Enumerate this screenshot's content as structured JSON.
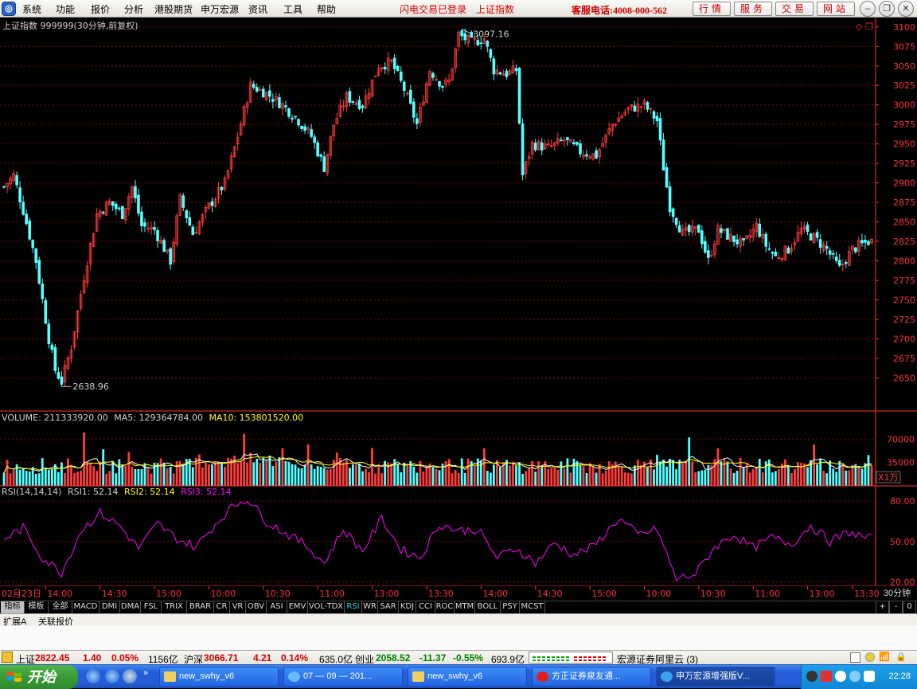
{
  "menubar": {
    "items": [
      "系统",
      "功能",
      "报价",
      "分析",
      "港股期货",
      "申万宏源",
      "资讯",
      "工具",
      "帮助"
    ],
    "flash_status": "闪电交易已登录",
    "current_index": "上证指数",
    "hotline": "客服电话:4008-000-562",
    "buttons": [
      "行情",
      "服务",
      "交易",
      "网站"
    ]
  },
  "chart": {
    "title": "上证指数 999999(30分钟,前复权)",
    "high_label": "3097.16",
    "low_label": "2638.96",
    "price_ticks": [
      "3100",
      "3075",
      "3050",
      "3025",
      "3000",
      "2975",
      "2950",
      "2925",
      "2900",
      "2875",
      "2850",
      "2825",
      "2800",
      "2775",
      "2750",
      "2725",
      "2700",
      "2675",
      "2650"
    ],
    "volume_header": {
      "label": "VOLUME: 211333920.00",
      "ma5": "MA5: 129364784.00",
      "ma10": "MA10: 153801520.00"
    },
    "volume_ticks": [
      "70000",
      "35000"
    ],
    "volume_unit": "X1万",
    "rsi_header": {
      "label": "RSI(14,14,14)",
      "rsi1": "RSI1: 52.14",
      "rsi2": "RSI2: 52.14",
      "rsi3": "RSI3: 52.14"
    },
    "rsi_ticks": [
      "80.00",
      "50.00",
      "20.00"
    ],
    "time_axis": [
      "02月23日",
      "14:00",
      "14:30",
      "15:00",
      "10:00",
      "10:30",
      "11:00",
      "13:00",
      "13:30",
      "14:00",
      "14:30",
      "15:00",
      "10:00",
      "10:30",
      "11:00",
      "13:00",
      "13:30"
    ],
    "colors": {
      "up": "#ff3c3c",
      "down": "#54ffff",
      "grid": "#8b0000",
      "ma5": "#ffffff",
      "ma10": "#ffff00",
      "rsi": "#ff00ff",
      "axis": "#ff3030"
    }
  },
  "chart_data": {
    "type": "candlestick",
    "title": "上证指数 999999(30分钟,前复权)",
    "ylim": [
      2630,
      3110
    ],
    "max_price": 3097.16,
    "min_price": 2638.96,
    "close_path": [
      {
        "bar": 0,
        "close": 2895
      },
      {
        "bar": 3,
        "close": 2910
      },
      {
        "bar": 6,
        "close": 2865
      },
      {
        "bar": 10,
        "close": 2800
      },
      {
        "bar": 14,
        "close": 2700
      },
      {
        "bar": 16,
        "close": 2660
      },
      {
        "bar": 18,
        "close": 2645
      },
      {
        "bar": 21,
        "close": 2690
      },
      {
        "bar": 25,
        "close": 2780
      },
      {
        "bar": 29,
        "close": 2860
      },
      {
        "bar": 33,
        "close": 2875
      },
      {
        "bar": 37,
        "close": 2860
      },
      {
        "bar": 40,
        "close": 2895
      },
      {
        "bar": 43,
        "close": 2845
      },
      {
        "bar": 47,
        "close": 2840
      },
      {
        "bar": 52,
        "close": 2800
      },
      {
        "bar": 55,
        "close": 2880
      },
      {
        "bar": 59,
        "close": 2835
      },
      {
        "bar": 64,
        "close": 2870
      },
      {
        "bar": 69,
        "close": 2900
      },
      {
        "bar": 73,
        "close": 2960
      },
      {
        "bar": 77,
        "close": 3025
      },
      {
        "bar": 82,
        "close": 3015
      },
      {
        "bar": 87,
        "close": 3000
      },
      {
        "bar": 92,
        "close": 2980
      },
      {
        "bar": 96,
        "close": 2960
      },
      {
        "bar": 100,
        "close": 2920
      },
      {
        "bar": 103,
        "close": 2975
      },
      {
        "bar": 107,
        "close": 3010
      },
      {
        "bar": 112,
        "close": 3000
      },
      {
        "bar": 117,
        "close": 3050
      },
      {
        "bar": 121,
        "close": 3055
      },
      {
        "bar": 125,
        "close": 3020
      },
      {
        "bar": 129,
        "close": 2975
      },
      {
        "bar": 133,
        "close": 3045
      },
      {
        "bar": 137,
        "close": 3025
      },
      {
        "bar": 139,
        "close": 3030
      },
      {
        "bar": 142,
        "close": 3090
      },
      {
        "bar": 146,
        "close": 3080
      },
      {
        "bar": 150,
        "close": 3085
      },
      {
        "bar": 153,
        "close": 3045
      },
      {
        "bar": 157,
        "close": 3040
      },
      {
        "bar": 160,
        "close": 3045
      },
      {
        "bar": 162,
        "close": 2910
      },
      {
        "bar": 165,
        "close": 2950
      },
      {
        "bar": 170,
        "close": 2945
      },
      {
        "bar": 175,
        "close": 2955
      },
      {
        "bar": 180,
        "close": 2940
      },
      {
        "bar": 185,
        "close": 2935
      },
      {
        "bar": 190,
        "close": 2975
      },
      {
        "bar": 195,
        "close": 2995
      },
      {
        "bar": 200,
        "close": 3000
      },
      {
        "bar": 204,
        "close": 2980
      },
      {
        "bar": 206,
        "close": 2920
      },
      {
        "bar": 208,
        "close": 2870
      },
      {
        "bar": 212,
        "close": 2835
      },
      {
        "bar": 217,
        "close": 2840
      },
      {
        "bar": 220,
        "close": 2800
      },
      {
        "bar": 223,
        "close": 2840
      },
      {
        "bar": 227,
        "close": 2830
      },
      {
        "bar": 231,
        "close": 2820
      },
      {
        "bar": 235,
        "close": 2845
      },
      {
        "bar": 238,
        "close": 2820
      },
      {
        "bar": 241,
        "close": 2805
      },
      {
        "bar": 245,
        "close": 2815
      },
      {
        "bar": 249,
        "close": 2840
      },
      {
        "bar": 253,
        "close": 2830
      },
      {
        "bar": 257,
        "close": 2815
      },
      {
        "bar": 261,
        "close": 2790
      },
      {
        "bar": 265,
        "close": 2815
      },
      {
        "bar": 270,
        "close": 2825
      }
    ],
    "total_bars": 272,
    "volume_unit": "X1万",
    "volume_ylim": [
      0,
      105000
    ],
    "rsi_ylim": [
      18,
      90
    ],
    "rsi_path": [
      {
        "bar": 0,
        "value": 52
      },
      {
        "bar": 6,
        "value": 60
      },
      {
        "bar": 12,
        "value": 38
      },
      {
        "bar": 18,
        "value": 27
      },
      {
        "bar": 24,
        "value": 58
      },
      {
        "bar": 30,
        "value": 71
      },
      {
        "bar": 36,
        "value": 62
      },
      {
        "bar": 42,
        "value": 45
      },
      {
        "bar": 48,
        "value": 63
      },
      {
        "bar": 54,
        "value": 52
      },
      {
        "bar": 60,
        "value": 46
      },
      {
        "bar": 66,
        "value": 63
      },
      {
        "bar": 72,
        "value": 77
      },
      {
        "bar": 76,
        "value": 82
      },
      {
        "bar": 82,
        "value": 65
      },
      {
        "bar": 88,
        "value": 56
      },
      {
        "bar": 94,
        "value": 48
      },
      {
        "bar": 100,
        "value": 34
      },
      {
        "bar": 106,
        "value": 59
      },
      {
        "bar": 112,
        "value": 43
      },
      {
        "bar": 118,
        "value": 67
      },
      {
        "bar": 124,
        "value": 44
      },
      {
        "bar": 130,
        "value": 38
      },
      {
        "bar": 136,
        "value": 63
      },
      {
        "bar": 142,
        "value": 58
      },
      {
        "bar": 148,
        "value": 59
      },
      {
        "bar": 154,
        "value": 38
      },
      {
        "bar": 160,
        "value": 45
      },
      {
        "bar": 166,
        "value": 34
      },
      {
        "bar": 172,
        "value": 49
      },
      {
        "bar": 178,
        "value": 40
      },
      {
        "bar": 184,
        "value": 46
      },
      {
        "bar": 192,
        "value": 67
      },
      {
        "bar": 198,
        "value": 55
      },
      {
        "bar": 204,
        "value": 59
      },
      {
        "bar": 210,
        "value": 22
      },
      {
        "bar": 216,
        "value": 26
      },
      {
        "bar": 222,
        "value": 46
      },
      {
        "bar": 228,
        "value": 55
      },
      {
        "bar": 234,
        "value": 45
      },
      {
        "bar": 240,
        "value": 53
      },
      {
        "bar": 246,
        "value": 48
      },
      {
        "bar": 252,
        "value": 62
      },
      {
        "bar": 258,
        "value": 50
      },
      {
        "bar": 264,
        "value": 57
      },
      {
        "bar": 270,
        "value": 52
      }
    ]
  },
  "indicator_tabs": [
    "指标",
    "模板",
    "全部",
    "MACD",
    "DMI",
    "DMA",
    "FSL",
    "TRIX",
    "BRAR",
    "CR",
    "VR",
    "OBV",
    "ASI",
    "EMV",
    "VOL-TDX",
    "RSI",
    "WR",
    "SAR",
    "KDJ",
    "CCI",
    "ROC",
    "MTM",
    "BOLL",
    "PSY",
    "MCST"
  ],
  "active_tab": "RSI",
  "period": "30分钟",
  "zoom_controls": [
    "+",
    "-",
    "0"
  ],
  "ext_row": [
    "扩展A",
    "关联报价"
  ],
  "statusbar": {
    "sh_label": "上证",
    "sh_value": "2822.45",
    "sh_chg": "1.40",
    "sh_pct": "0.05%",
    "sh_amt": "1156亿",
    "hs_label": "沪深",
    "hs_value": "3066.71",
    "hs_chg": "4.21",
    "hs_pct": "0.14%",
    "hs_amt": "635.0亿",
    "cy_label": "创业",
    "cy_value": "2058.52",
    "cy_chg": "-11.37",
    "cy_pct": "-0.55%",
    "cy_amt": "693.9亿",
    "server": "宏源证券阿里云 (3)"
  },
  "taskbar": {
    "start": "开始",
    "tasks": [
      "new_swhy_v6",
      "07 — 09 — 201...",
      "new_swhy_v6",
      "方正证券泉友通...",
      "申万宏源增强版V..."
    ],
    "clock": "22:28"
  }
}
